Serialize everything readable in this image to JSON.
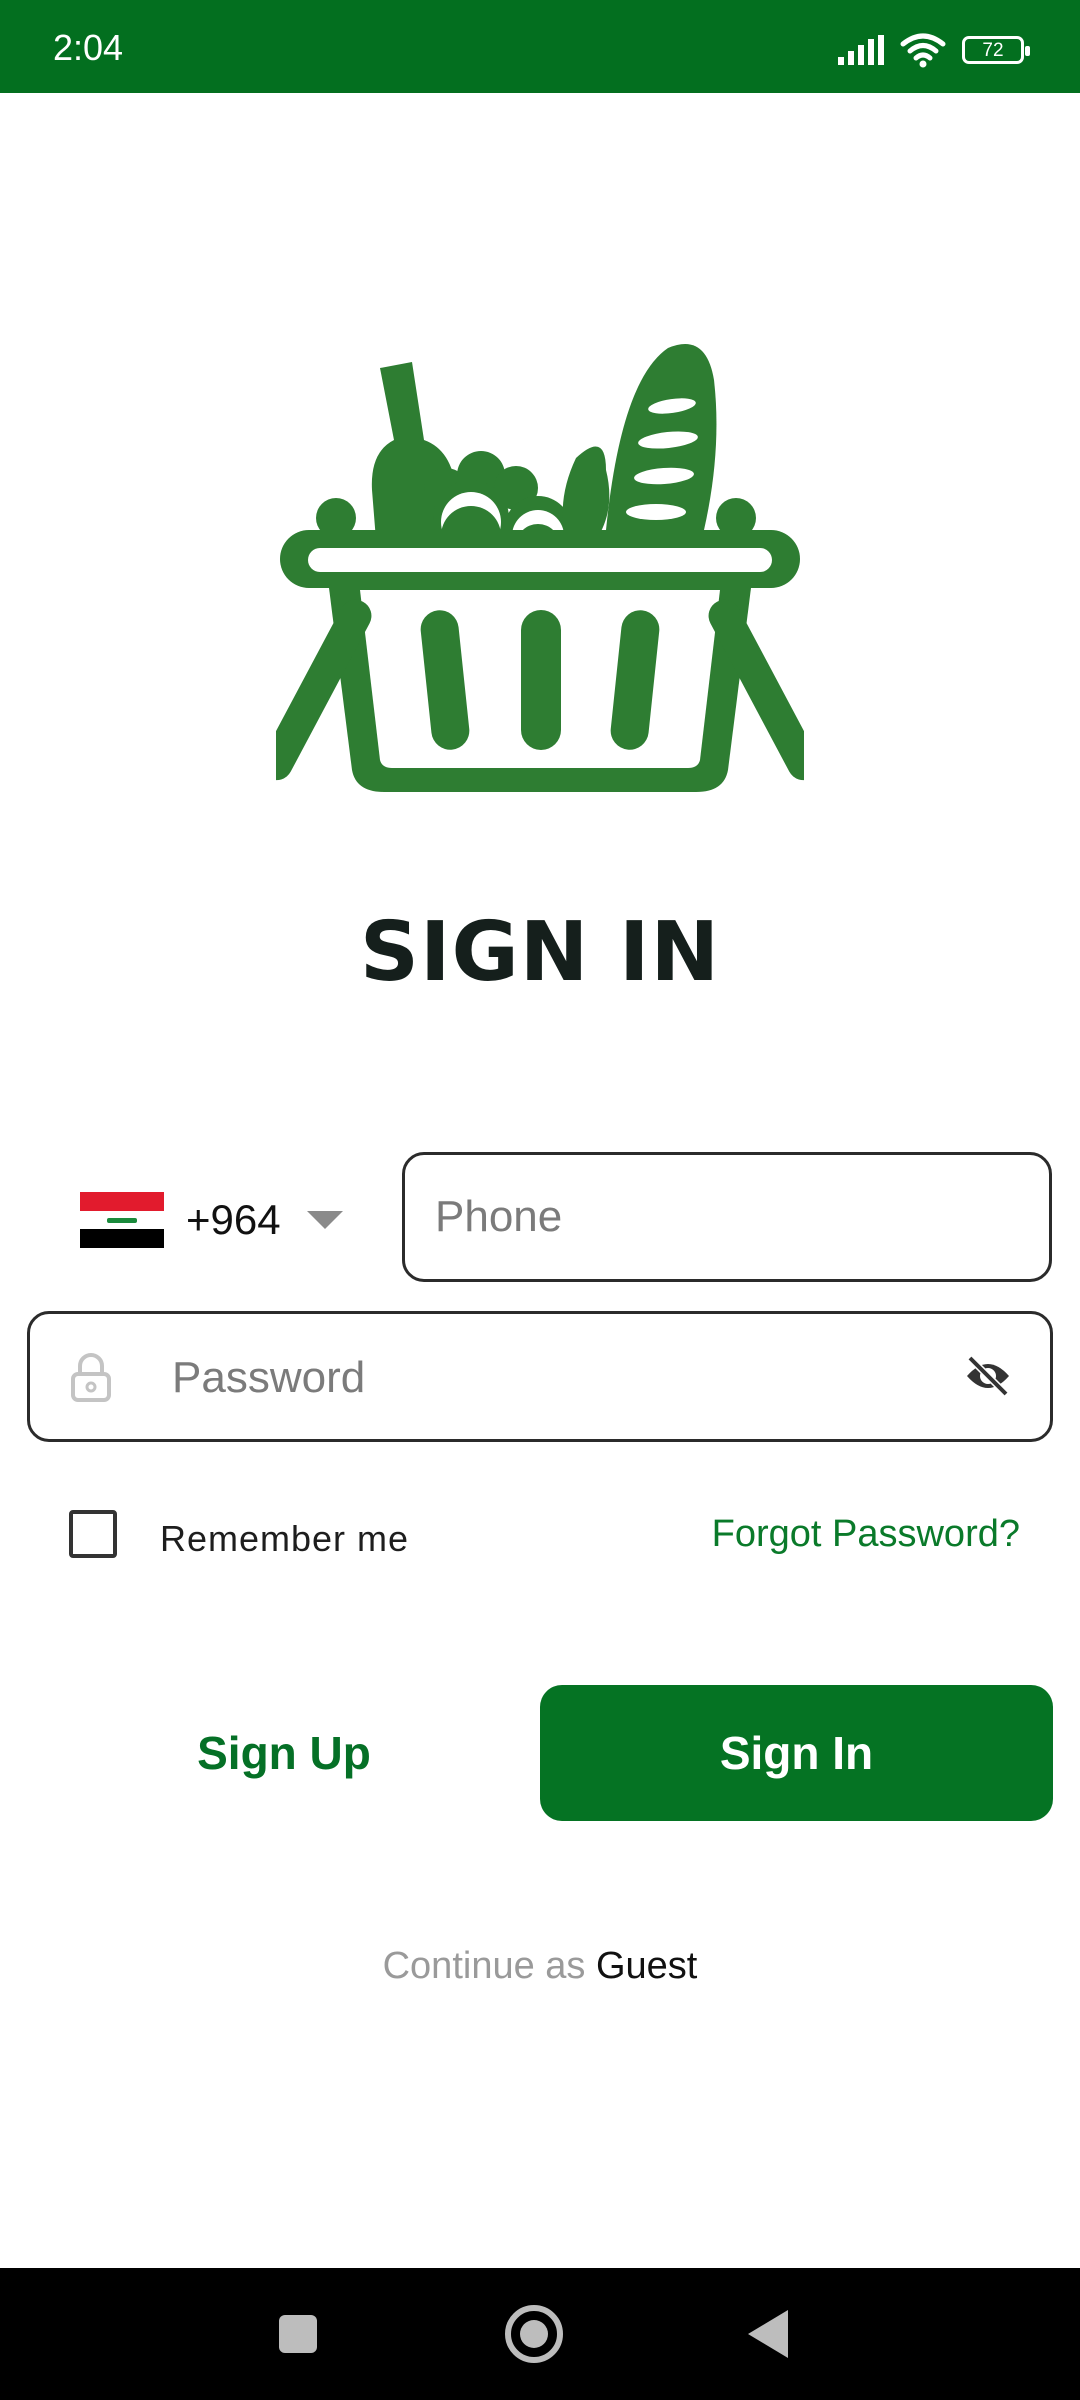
{
  "status_bar": {
    "time": "2:04",
    "battery": "72",
    "color": "#036f1f"
  },
  "logo": {
    "icon": "grocery-basket-icon",
    "color": "#2e7d32"
  },
  "title": "SIGN IN",
  "country": {
    "code": "+964",
    "flag": "iraq-flag-icon"
  },
  "phone": {
    "placeholder": "Phone",
    "value": ""
  },
  "password": {
    "placeholder": "Password",
    "value": ""
  },
  "remember": {
    "label": "Remember me",
    "checked": false
  },
  "forgot": "Forgot Password?",
  "buttons": {
    "sign_up": "Sign Up",
    "sign_in": "Sign In"
  },
  "guest": {
    "prefix": "Continue as",
    "link": "Guest"
  },
  "colors": {
    "primary": "#057323",
    "text_dark": "#151f1c"
  }
}
